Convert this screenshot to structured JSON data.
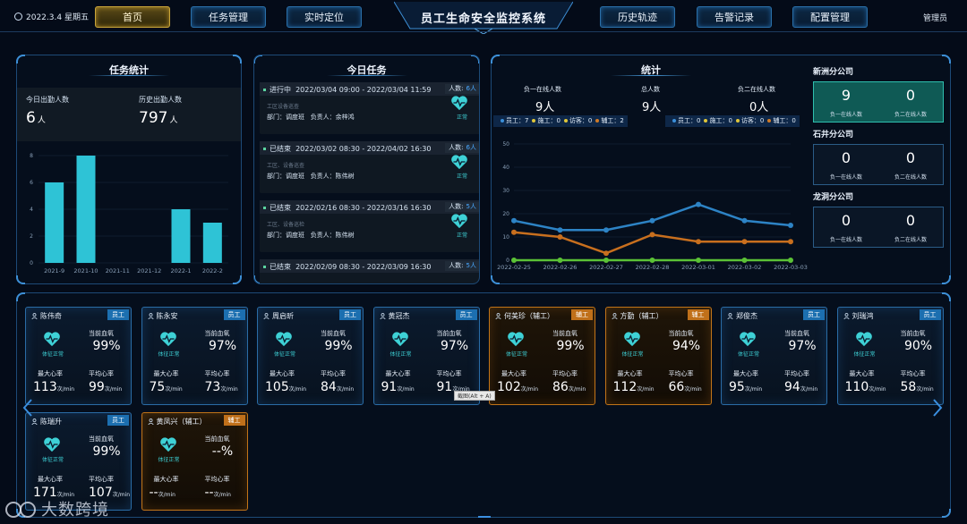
{
  "header": {
    "date": "2022.3.4 星期五",
    "title": "员工生命安全监控系统",
    "user": "管理员",
    "nav_left": [
      "首页",
      "任务管理",
      "实时定位"
    ],
    "nav_right": [
      "历史轨迹",
      "告警记录",
      "配置管理"
    ],
    "active_nav": "首页",
    "accent_color": "#c9a53a"
  },
  "task_stats": {
    "title": "任务统计",
    "today_label": "今日出勤人数",
    "today_value": "6",
    "today_unit": "人",
    "history_label": "历史出勤人数",
    "history_value": "797",
    "history_unit": "人",
    "chart_data": {
      "type": "bar",
      "categories": [
        "2021-9",
        "2021-10",
        "2021-11",
        "2021-12",
        "2022-1",
        "2022-2"
      ],
      "values": [
        6,
        8,
        0,
        0,
        4,
        3
      ],
      "ylim": [
        0,
        8
      ],
      "yticks": [
        "0",
        "2",
        "4",
        "6",
        "8"
      ],
      "bar_color": "#2ec3d6"
    }
  },
  "today_tasks": {
    "title": "今日任务",
    "items": [
      {
        "status": "进行中",
        "time": "2022/03/04 09:00 - 2022/03/04 11:59",
        "count_label": "人数:",
        "count": "6人",
        "desc": "工区设备巡查",
        "dept": "部门：调度班",
        "leader": "负责人：余梓鸿",
        "health": "正常"
      },
      {
        "status": "已结束",
        "time": "2022/03/02 08:30 - 2022/04/02 16:30",
        "count_label": "人数:",
        "count": "6人",
        "desc": "工区、设备巡查",
        "dept": "部门：调度班",
        "leader": "负责人：陈伟树",
        "health": "正常"
      },
      {
        "status": "已结束",
        "time": "2022/02/16 08:30 - 2022/03/16 16:30",
        "count_label": "人数:",
        "count": "5人",
        "desc": "工区、设备巡检",
        "dept": "部门：调度班",
        "leader": "负责人：陈伟树",
        "health": "正常"
      },
      {
        "status": "已结束",
        "time": "2022/02/09 08:30 - 2022/03/09 16:30",
        "count_label": "人数:",
        "count": "5人",
        "desc": "",
        "dept": "",
        "leader": "",
        "health": ""
      }
    ]
  },
  "overview": {
    "title": "统计",
    "l1_label": "负一在线人数",
    "l1_value": "9人",
    "total_label": "总人数",
    "total_value": "9人",
    "l2_label": "负二在线人数",
    "l2_value": "0人",
    "legend_l1": [
      {
        "name": "员工：7",
        "color": "#3b8fd9"
      },
      {
        "name": "施工：0",
        "color": "#e0c63a"
      },
      {
        "name": "访客：0",
        "color": "#e0c63a"
      },
      {
        "name": "辅工：2",
        "color": "#d07a26"
      }
    ],
    "legend_l2": [
      {
        "name": "员工：0",
        "color": "#3b8fd9"
      },
      {
        "name": "施工：0",
        "color": "#e0c63a"
      },
      {
        "name": "访客：0",
        "color": "#e0c63a"
      },
      {
        "name": "辅工：0",
        "color": "#d07a26"
      }
    ],
    "chart_data": {
      "type": "line",
      "x": [
        "2022-02-25",
        "2022-02-26",
        "2022-02-27",
        "2022-02-28",
        "2022-03-01",
        "2022-03-02",
        "2022-03-03"
      ],
      "ylim": [
        0,
        50
      ],
      "yticks": [
        "0",
        "10",
        "20",
        "30",
        "40",
        "50"
      ],
      "series": [
        {
          "values": [
            17,
            13,
            13,
            17,
            24,
            17,
            15
          ],
          "color": "#2d83c5"
        },
        {
          "values": [
            12,
            10,
            3,
            11,
            8,
            8,
            8
          ],
          "color": "#c86f1e"
        },
        {
          "values": [
            0,
            0,
            0,
            0,
            0,
            0,
            0
          ],
          "color": "#5bc236"
        }
      ]
    },
    "companies": [
      {
        "name": "新洲分公司",
        "v1": "9",
        "v2": "0",
        "l1": "负一在线人数",
        "l2": "负二在线人数",
        "highlight": true
      },
      {
        "name": "石井分公司",
        "v1": "0",
        "v2": "0",
        "l1": "负一在线人数",
        "l2": "负二在线人数",
        "highlight": false
      },
      {
        "name": "龙洞分公司",
        "v1": "0",
        "v2": "0",
        "l1": "负一在线人数",
        "l2": "负二在线人数",
        "highlight": false
      }
    ]
  },
  "workers": {
    "labels": {
      "health": "体征正常",
      "o2": "当前血氧",
      "max_hr": "最大心率",
      "avg_hr": "平均心率",
      "unit": "次/min"
    },
    "items": [
      {
        "name": "陈伟奇",
        "tag": "员工",
        "aux": false,
        "o2": "99%",
        "max": "113",
        "avg": "99"
      },
      {
        "name": "陈永安",
        "tag": "员工",
        "aux": false,
        "o2": "97%",
        "max": "75",
        "avg": "73"
      },
      {
        "name": "周启昕",
        "tag": "员工",
        "aux": false,
        "o2": "99%",
        "max": "105",
        "avg": "84"
      },
      {
        "name": "黄冠杰",
        "tag": "员工",
        "aux": false,
        "o2": "97%",
        "max": "91",
        "avg": "91"
      },
      {
        "name": "何美珍（辅工）",
        "tag": "辅工",
        "aux": true,
        "o2": "99%",
        "max": "102",
        "avg": "86"
      },
      {
        "name": "方勤（辅工）",
        "tag": "辅工",
        "aux": true,
        "o2": "94%",
        "max": "112",
        "avg": "66"
      },
      {
        "name": "郑俊杰",
        "tag": "员工",
        "aux": false,
        "o2": "97%",
        "max": "95",
        "avg": "94"
      },
      {
        "name": "刘瑞鸿",
        "tag": "员工",
        "aux": false,
        "o2": "90%",
        "max": "110",
        "avg": "58"
      },
      {
        "name": "陈瑞升",
        "tag": "员工",
        "aux": false,
        "o2": "99%",
        "max": "171",
        "avg": "107"
      },
      {
        "name": "黄凤兴（辅工）",
        "tag": "辅工",
        "aux": true,
        "o2": "--%",
        "max": "--",
        "avg": "--"
      }
    ]
  },
  "tooltip": "截图(Alt + A)",
  "watermark": "大数跨境"
}
